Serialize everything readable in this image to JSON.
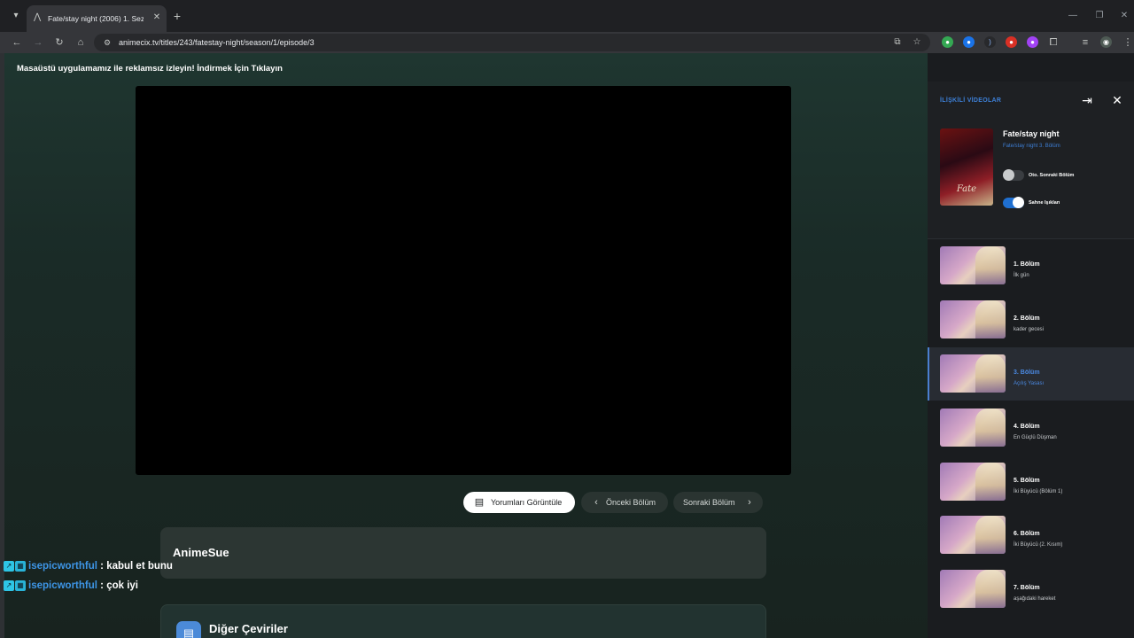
{
  "browser": {
    "tab_title": "Fate/stay night (2006) 1. Sezon",
    "url": "animecix.tv/titles/243/fatestay-night/season/1/episode/3"
  },
  "page": {
    "promo_text": "Masaüstü uygulamamız ile reklamsız izleyin! İndirmek İçin Tıklayın",
    "buttons": {
      "comments": "Yorumları Görüntüle",
      "prev": "Önceki Bölüm",
      "next": "Sonraki Bölüm"
    },
    "fansub": "AnimeSue",
    "other_translations": "Diğer Çeviriler"
  },
  "chat": [
    {
      "user": "isepicworthful",
      "sep": " : ",
      "message": "kabul et bunu"
    },
    {
      "user": "isepicworthful",
      "sep": " : ",
      "message": "çok iyi"
    }
  ],
  "sidebar": {
    "title": "İLİŞKİLİ VİDEOLAR",
    "anime_title": "Fate/stay night",
    "anime_subtitle": "Fate/stay night 3. Bölüm",
    "poster_logo": "Fate",
    "autoplay_label": "Oto. Sonraki Bölüm",
    "autoplay_on": false,
    "scene_label": "Sahne Işıkları",
    "scene_on": true,
    "episodes": [
      {
        "num": "1. Bölüm",
        "name": "İlk gün"
      },
      {
        "num": "2. Bölüm",
        "name": "kader gecesi"
      },
      {
        "num": "3. Bölüm",
        "name": "Açılış Yasası"
      },
      {
        "num": "4. Bölüm",
        "name": "En Güçlü Düşman"
      },
      {
        "num": "5. Bölüm",
        "name": "İki Büyücü (Bölüm 1)"
      },
      {
        "num": "6. Bölüm",
        "name": "İki Büyücü (2. Kısım)"
      },
      {
        "num": "7. Bölüm",
        "name": "aşağıdaki hareket"
      }
    ]
  },
  "colors": {
    "accent": "#3d7fd6",
    "chat_user": "#3d95e6"
  },
  "icons": [
    "tab-menu-icon",
    "favicon-icon",
    "close-icon",
    "plus-icon",
    "back-icon",
    "forward-icon",
    "reload-icon",
    "home-icon",
    "site-info-icon",
    "install-icon",
    "star-icon",
    "extensions-icon",
    "media-icon",
    "profile-icon",
    "menu-icon",
    "comment-icon",
    "chevron-left-icon",
    "chevron-right-icon",
    "collapse-icon",
    "document-icon"
  ]
}
